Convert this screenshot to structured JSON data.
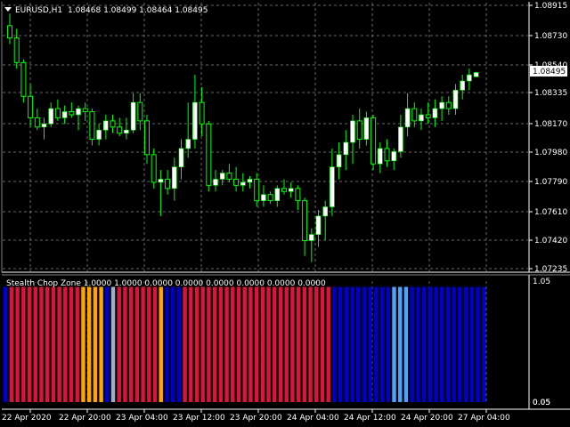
{
  "window": {
    "symbol_title": "EURUSD,H1",
    "ohlc_text": "1.08468 1.08499 1.08464 1.08495",
    "current_price_label": "1.08495",
    "menu_icon": "triangle-down-icon"
  },
  "indicator": {
    "header_text": "Stealth Chop Zone 1.0000 1.0000 0.0000 0.0000 0.0000 0.0000 0.0000 0.0000",
    "scale_labels": [
      "1.05",
      "0.05",
      "0.05"
    ]
  },
  "colors": {
    "background": "#000000",
    "grid": "#c0c0c0",
    "candle_up": "#ffffff",
    "candle_wick": "#00ff00",
    "zone_red": "#dc143c",
    "zone_orange": "#ffa500",
    "zone_lightblue": "#4ea3ff",
    "zone_darkblue": "#0000cd",
    "zone_gray": "#9bb0c8",
    "current_price_box": "#ffffff"
  },
  "chart_data": [
    {
      "type": "candlestick",
      "title": "EURUSD,H1",
      "ylim": [
        1.072,
        1.0895
      ],
      "y_ticks": [
        "1.08915",
        "1.08730",
        "1.08540",
        "1.08335",
        "1.08170",
        "1.07980",
        "1.07790",
        "1.07610",
        "1.07420",
        "1.07235"
      ],
      "x_ticks": [
        "22 Apr 2020",
        "22 Apr 20:00",
        "23 Apr 04:00",
        "23 Apr 12:00",
        "23 Apr 20:00",
        "24 Apr 04:00",
        "24 Apr 12:00",
        "24 Apr 20:00",
        "27 Apr 04:00"
      ],
      "grid": true,
      "candles": [
        {
          "o": 1.088,
          "h": 1.0888,
          "l": 1.0868,
          "c": 1.0872
        },
        {
          "o": 1.0872,
          "h": 1.0878,
          "l": 1.0852,
          "c": 1.0856
        },
        {
          "o": 1.0856,
          "h": 1.0858,
          "l": 1.083,
          "c": 1.0834
        },
        {
          "o": 1.0834,
          "h": 1.0842,
          "l": 1.0814,
          "c": 1.082
        },
        {
          "o": 1.082,
          "h": 1.0826,
          "l": 1.0812,
          "c": 1.0814
        },
        {
          "o": 1.0814,
          "h": 1.082,
          "l": 1.0806,
          "c": 1.0816
        },
        {
          "o": 1.0816,
          "h": 1.083,
          "l": 1.0814,
          "c": 1.0826
        },
        {
          "o": 1.0826,
          "h": 1.0832,
          "l": 1.0818,
          "c": 1.082
        },
        {
          "o": 1.082,
          "h": 1.0828,
          "l": 1.0816,
          "c": 1.0824
        },
        {
          "o": 1.0824,
          "h": 1.083,
          "l": 1.082,
          "c": 1.0822
        },
        {
          "o": 1.0822,
          "h": 1.0828,
          "l": 1.0812,
          "c": 1.0826
        },
        {
          "o": 1.0826,
          "h": 1.083,
          "l": 1.0818,
          "c": 1.0824
        },
        {
          "o": 1.0824,
          "h": 1.0826,
          "l": 1.0802,
          "c": 1.0806
        },
        {
          "o": 1.0806,
          "h": 1.0816,
          "l": 1.0802,
          "c": 1.0812
        },
        {
          "o": 1.0812,
          "h": 1.0822,
          "l": 1.0806,
          "c": 1.0818
        },
        {
          "o": 1.0818,
          "h": 1.0822,
          "l": 1.081,
          "c": 1.0814
        },
        {
          "o": 1.0814,
          "h": 1.082,
          "l": 1.0808,
          "c": 1.081
        },
        {
          "o": 1.081,
          "h": 1.082,
          "l": 1.0806,
          "c": 1.0812
        },
        {
          "o": 1.0812,
          "h": 1.0836,
          "l": 1.081,
          "c": 1.083
        },
        {
          "o": 1.083,
          "h": 1.0836,
          "l": 1.0812,
          "c": 1.0818
        },
        {
          "o": 1.0818,
          "h": 1.0822,
          "l": 1.079,
          "c": 1.0796
        },
        {
          "o": 1.0796,
          "h": 1.08,
          "l": 1.0774,
          "c": 1.0778
        },
        {
          "o": 1.0778,
          "h": 1.0786,
          "l": 1.0756,
          "c": 1.078
        },
        {
          "o": 1.078,
          "h": 1.0786,
          "l": 1.077,
          "c": 1.0774
        },
        {
          "o": 1.0774,
          "h": 1.0794,
          "l": 1.0766,
          "c": 1.0788
        },
        {
          "o": 1.0788,
          "h": 1.0806,
          "l": 1.078,
          "c": 1.08
        },
        {
          "o": 1.08,
          "h": 1.083,
          "l": 1.0794,
          "c": 1.0806
        },
        {
          "o": 1.0806,
          "h": 1.0848,
          "l": 1.08,
          "c": 1.083
        },
        {
          "o": 1.083,
          "h": 1.084,
          "l": 1.0808,
          "c": 1.0816
        },
        {
          "o": 1.0816,
          "h": 1.0818,
          "l": 1.0772,
          "c": 1.0776
        },
        {
          "o": 1.0776,
          "h": 1.0786,
          "l": 1.0772,
          "c": 1.078
        },
        {
          "o": 1.078,
          "h": 1.0786,
          "l": 1.0776,
          "c": 1.0784
        },
        {
          "o": 1.0784,
          "h": 1.079,
          "l": 1.0778,
          "c": 1.078
        },
        {
          "o": 1.078,
          "h": 1.0788,
          "l": 1.0772,
          "c": 1.0776
        },
        {
          "o": 1.0776,
          "h": 1.0784,
          "l": 1.0772,
          "c": 1.0778
        },
        {
          "o": 1.0778,
          "h": 1.0782,
          "l": 1.0774,
          "c": 1.078
        },
        {
          "o": 1.078,
          "h": 1.0784,
          "l": 1.0762,
          "c": 1.0766
        },
        {
          "o": 1.0766,
          "h": 1.0776,
          "l": 1.0762,
          "c": 1.077
        },
        {
          "o": 1.077,
          "h": 1.0772,
          "l": 1.0764,
          "c": 1.0766
        },
        {
          "o": 1.0766,
          "h": 1.0776,
          "l": 1.0762,
          "c": 1.0774
        },
        {
          "o": 1.0774,
          "h": 1.078,
          "l": 1.077,
          "c": 1.0772
        },
        {
          "o": 1.0772,
          "h": 1.0778,
          "l": 1.0768,
          "c": 1.0774
        },
        {
          "o": 1.0774,
          "h": 1.0776,
          "l": 1.076,
          "c": 1.0766
        },
        {
          "o": 1.0766,
          "h": 1.0768,
          "l": 1.073,
          "c": 1.074
        },
        {
          "o": 1.074,
          "h": 1.0748,
          "l": 1.0726,
          "c": 1.0744
        },
        {
          "o": 1.0744,
          "h": 1.076,
          "l": 1.0736,
          "c": 1.0756
        },
        {
          "o": 1.0756,
          "h": 1.0766,
          "l": 1.074,
          "c": 1.0762
        },
        {
          "o": 1.0762,
          "h": 1.08,
          "l": 1.0756,
          "c": 1.0788
        },
        {
          "o": 1.0788,
          "h": 1.0804,
          "l": 1.078,
          "c": 1.0796
        },
        {
          "o": 1.0796,
          "h": 1.0812,
          "l": 1.0786,
          "c": 1.0804
        },
        {
          "o": 1.0804,
          "h": 1.0822,
          "l": 1.079,
          "c": 1.0818
        },
        {
          "o": 1.0818,
          "h": 1.0826,
          "l": 1.08,
          "c": 1.0806
        },
        {
          "o": 1.0806,
          "h": 1.0824,
          "l": 1.0802,
          "c": 1.082
        },
        {
          "o": 1.082,
          "h": 1.0822,
          "l": 1.0786,
          "c": 1.079
        },
        {
          "o": 1.079,
          "h": 1.0804,
          "l": 1.0784,
          "c": 1.08
        },
        {
          "o": 1.08,
          "h": 1.0806,
          "l": 1.0788,
          "c": 1.0792
        },
        {
          "o": 1.0792,
          "h": 1.08,
          "l": 1.0786,
          "c": 1.0798
        },
        {
          "o": 1.0798,
          "h": 1.0822,
          "l": 1.0794,
          "c": 1.0814
        },
        {
          "o": 1.0814,
          "h": 1.0836,
          "l": 1.0808,
          "c": 1.0826
        },
        {
          "o": 1.0826,
          "h": 1.083,
          "l": 1.0814,
          "c": 1.0818
        },
        {
          "o": 1.0818,
          "h": 1.0826,
          "l": 1.0812,
          "c": 1.0822
        },
        {
          "o": 1.0822,
          "h": 1.083,
          "l": 1.0816,
          "c": 1.082
        },
        {
          "o": 1.082,
          "h": 1.0832,
          "l": 1.0814,
          "c": 1.0826
        },
        {
          "o": 1.0826,
          "h": 1.0834,
          "l": 1.0818,
          "c": 1.083
        },
        {
          "o": 1.083,
          "h": 1.0834,
          "l": 1.0822,
          "c": 1.0826
        },
        {
          "o": 1.0826,
          "h": 1.0842,
          "l": 1.0822,
          "c": 1.0838
        },
        {
          "o": 1.0838,
          "h": 1.0848,
          "l": 1.0832,
          "c": 1.0844
        },
        {
          "o": 1.0844,
          "h": 1.0852,
          "l": 1.0838,
          "c": 1.0848
        },
        {
          "o": 1.08468,
          "h": 1.08499,
          "l": 1.08464,
          "c": 1.08495
        }
      ]
    },
    {
      "type": "bar",
      "title": "Stealth Chop Zone",
      "ylim": [
        0,
        1.05
      ],
      "values_all": 1.0,
      "zone_colors": [
        "darkblue",
        "red",
        "red",
        "red",
        "red",
        "red",
        "red",
        "red",
        "red",
        "red",
        "red",
        "red",
        "red",
        "orange",
        "orange",
        "orange",
        "orange",
        "darkblue",
        "gray",
        "red",
        "red",
        "red",
        "red",
        "red",
        "red",
        "red",
        "orange",
        "darkblue",
        "darkblue",
        "darkblue",
        "red",
        "red",
        "red",
        "red",
        "red",
        "red",
        "red",
        "red",
        "red",
        "red",
        "red",
        "red",
        "red",
        "red",
        "red",
        "red",
        "red",
        "red",
        "red",
        "red",
        "red",
        "red",
        "red",
        "red",
        "red",
        "darkblue",
        "darkblue",
        "darkblue",
        "darkblue",
        "darkblue",
        "darkblue",
        "darkblue",
        "darkblue",
        "darkblue",
        "darkblue",
        "lightblue",
        "lightblue",
        "lightblue",
        "darkblue",
        "darkblue",
        "darkblue",
        "darkblue",
        "darkblue",
        "darkblue",
        "darkblue",
        "darkblue",
        "darkblue",
        "darkblue",
        "darkblue",
        "darkblue",
        "darkblue"
      ]
    }
  ]
}
